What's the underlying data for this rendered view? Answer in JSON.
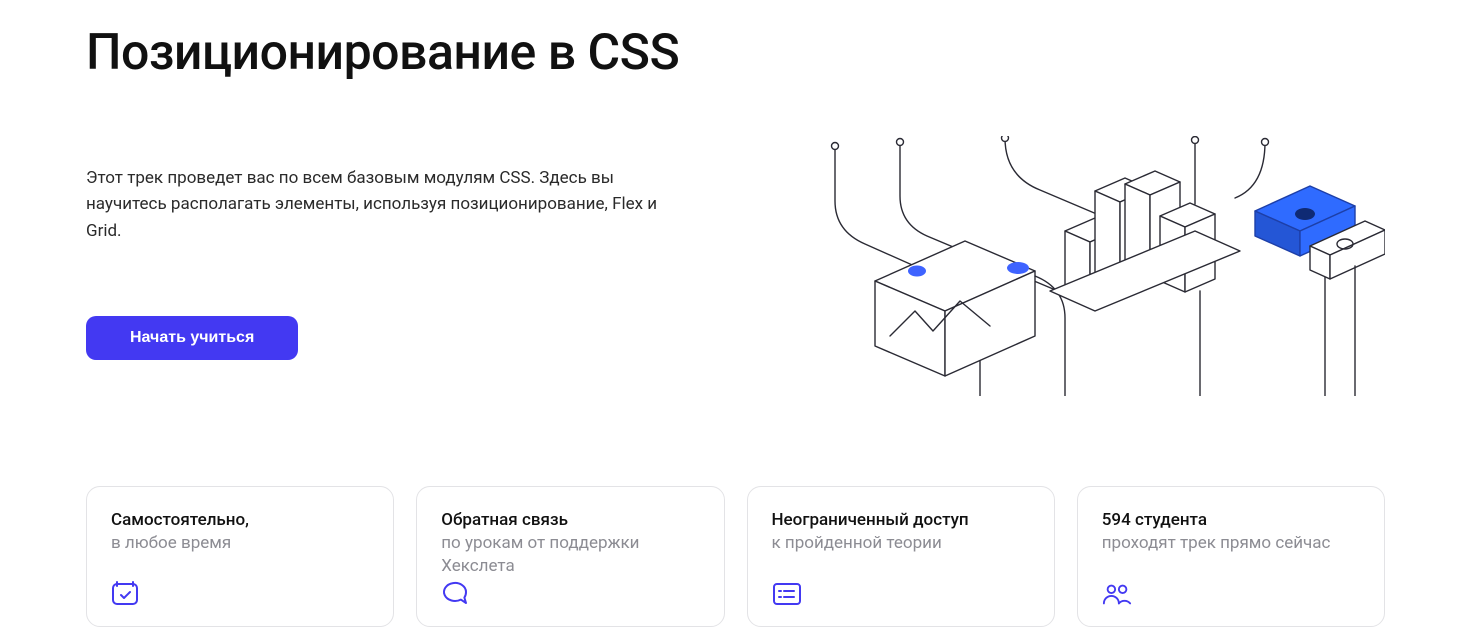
{
  "hero": {
    "title": "Позиционирование в CSS",
    "description": "Этот трек проведет вас по всем базовым модулям CSS. Здесь вы научитесь располагать элементы, используя позиционирование, Flex и Grid.",
    "cta_label": "Начать учиться"
  },
  "cards": [
    {
      "title": "Самостоятельно,",
      "sub": "в любое время",
      "icon": "calendar-check-icon"
    },
    {
      "title": "Обратная связь",
      "sub": "по урокам от поддержки Хекслета",
      "icon": "chat-icon"
    },
    {
      "title": "Неограниченный доступ",
      "sub": "к пройденной теории",
      "icon": "list-check-icon"
    },
    {
      "title": "594 студента",
      "sub": "проходят трек прямо сейчас",
      "icon": "users-icon"
    }
  ],
  "colors": {
    "accent": "#4339F2"
  }
}
